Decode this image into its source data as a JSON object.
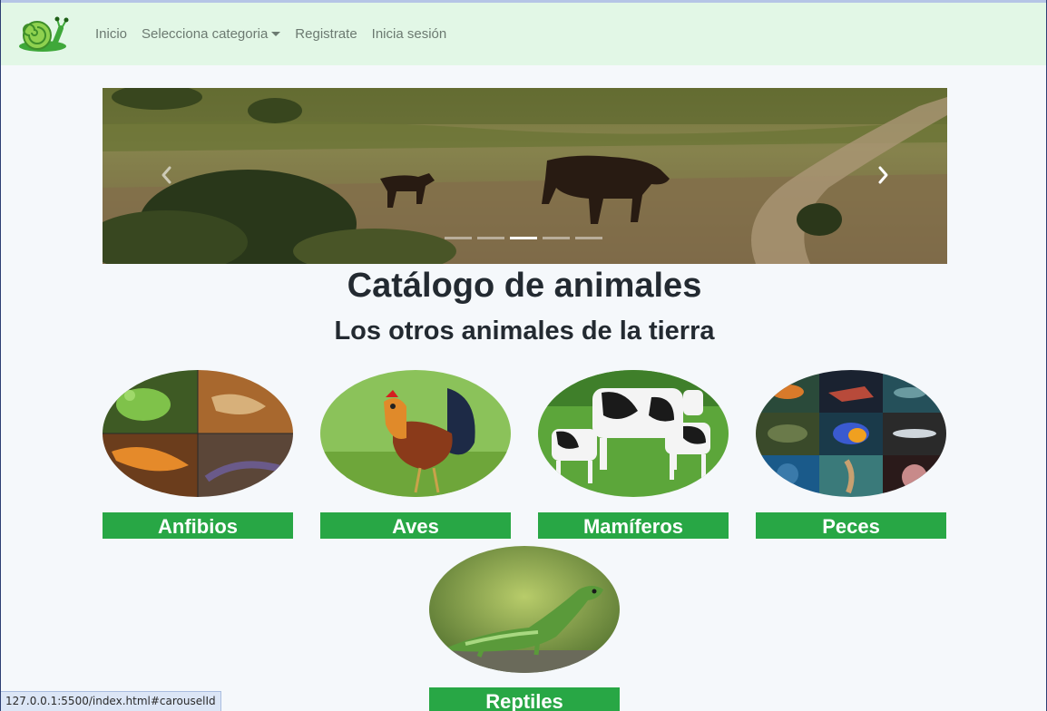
{
  "navbar": {
    "logo_icon": "snail-icon",
    "links": [
      {
        "label": "Inicio"
      },
      {
        "label": "Selecciona categoria",
        "dropdown": true
      },
      {
        "label": "Registrate"
      },
      {
        "label": "Inicia sesión"
      }
    ]
  },
  "carousel": {
    "slide_image": "cattle-in-field-photo",
    "indicators_count": 5,
    "active_index": 2,
    "prev_icon": "chevron-left-icon",
    "next_icon": "chevron-right-icon"
  },
  "page": {
    "title": "Catálogo de animales",
    "subtitle": "Los otros animales de la tierra"
  },
  "categories": [
    {
      "label": "Anfibios",
      "image": "amphibians-collage-photo"
    },
    {
      "label": "Aves",
      "image": "rooster-photo"
    },
    {
      "label": "Mamíferos",
      "image": "cows-photo"
    },
    {
      "label": "Peces",
      "image": "fish-collage-photo"
    },
    {
      "label": "Reptiles",
      "image": "iguana-photo"
    }
  ],
  "status_bar": {
    "url": "127.0.0.1:5500/index.html#carouselId"
  },
  "colors": {
    "navbar_bg": "#e2f7e6",
    "page_bg": "#f5f8fb",
    "button_green": "#28a745",
    "heading_text": "#232a31"
  }
}
